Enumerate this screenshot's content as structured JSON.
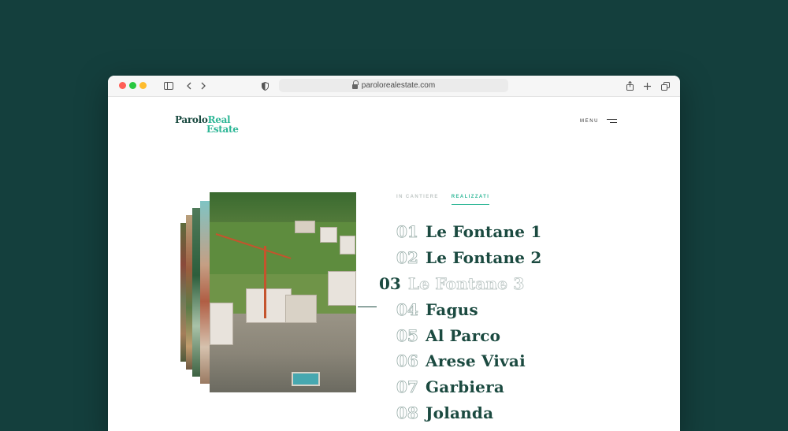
{
  "browser": {
    "url": "parolorealestate.com"
  },
  "site": {
    "logo": {
      "line1_a": "Parolo",
      "line1_b": "Real",
      "line2": "Estate"
    },
    "menu_label": "MENU"
  },
  "filters": [
    {
      "label": "IN CANTIERE",
      "active": false
    },
    {
      "label": "REALIZZATI",
      "active": true
    }
  ],
  "projects": [
    {
      "number": "01",
      "name": "Le Fontane 1",
      "active": false
    },
    {
      "number": "02",
      "name": "Le Fontane 2",
      "active": false
    },
    {
      "number": "03",
      "name": "Le Fontane 3",
      "active": true
    },
    {
      "number": "04",
      "name": "Fagus",
      "active": false
    },
    {
      "number": "05",
      "name": "Al Parco",
      "active": false
    },
    {
      "number": "06",
      "name": "Arese Vivai",
      "active": false
    },
    {
      "number": "07",
      "name": "Garbiera",
      "active": false
    },
    {
      "number": "08",
      "name": "Jolanda",
      "active": false
    }
  ],
  "colors": {
    "background": "#143f3d",
    "brand_dark": "#1b4a40",
    "brand_accent": "#2fb797"
  },
  "icons": [
    "sidebar-icon",
    "back-icon",
    "forward-icon",
    "shield-icon",
    "lock-icon",
    "share-icon",
    "new-tab-icon",
    "tabs-icon",
    "hamburger-icon"
  ]
}
